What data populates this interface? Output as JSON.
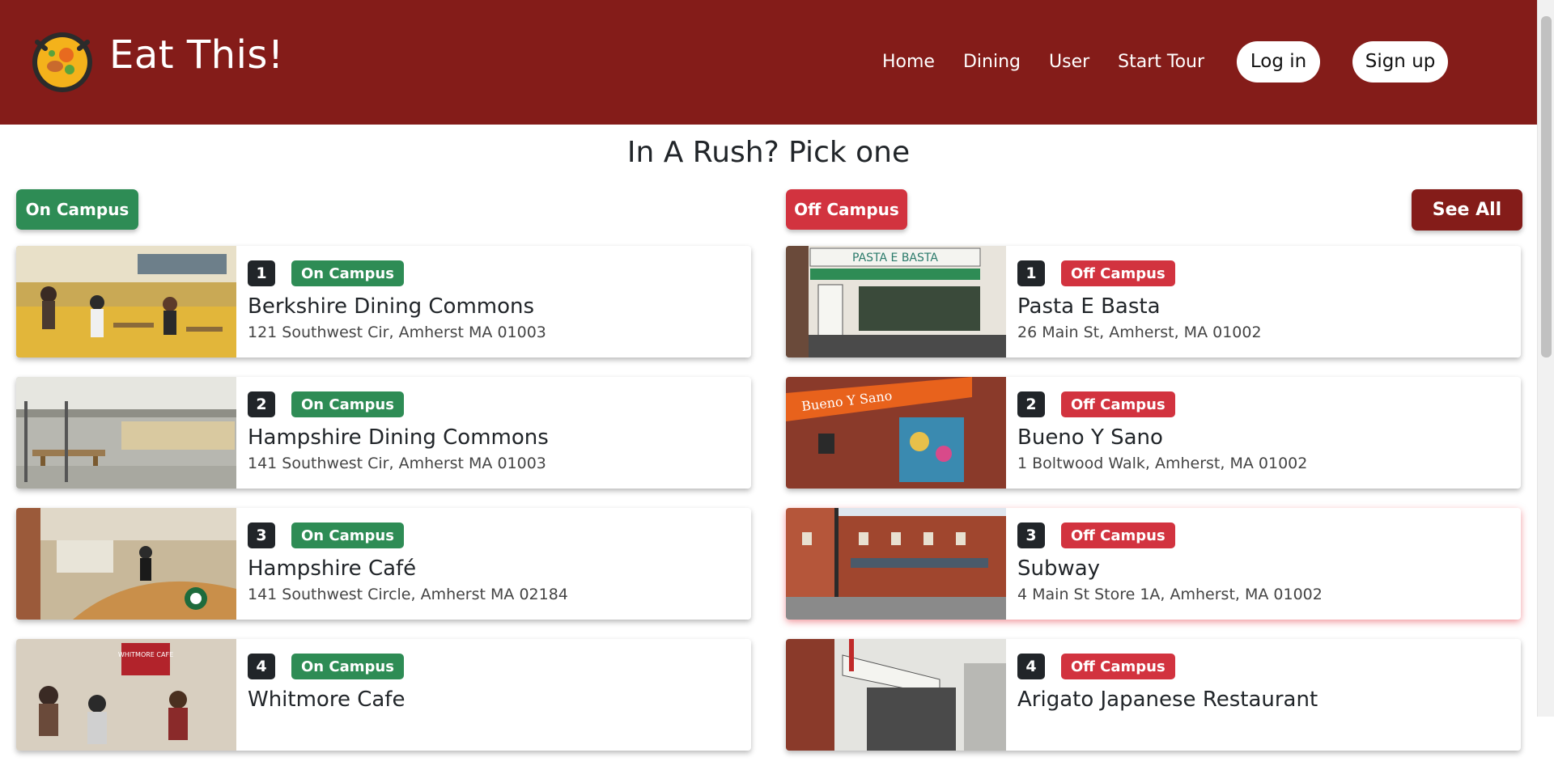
{
  "header": {
    "brand": "Eat This!",
    "nav": [
      "Home",
      "Dining",
      "User",
      "Start Tour"
    ],
    "login_label": "Log in",
    "signup_label": "Sign up",
    "bg_color": "#841c19"
  },
  "main": {
    "heading": "In A Rush? Pick one",
    "on_campus_label": "On Campus",
    "off_campus_label": "Off Campus",
    "see_all_label": "See All"
  },
  "on_campus": [
    {
      "rank": "1",
      "tag": "On Campus",
      "name": "Berkshire Dining Commons",
      "address": "121 Southwest Cir, Amherst MA 01003"
    },
    {
      "rank": "2",
      "tag": "On Campus",
      "name": "Hampshire Dining Commons",
      "address": "141 Southwest Cir, Amherst MA 01003"
    },
    {
      "rank": "3",
      "tag": "On Campus",
      "name": "Hampshire Café",
      "address": "141 Southwest Circle, Amherst MA 02184"
    },
    {
      "rank": "4",
      "tag": "On Campus",
      "name": "Whitmore Cafe",
      "address": ""
    }
  ],
  "off_campus": [
    {
      "rank": "1",
      "tag": "Off Campus",
      "name": "Pasta E Basta",
      "address": "26 Main St, Amherst, MA 01002"
    },
    {
      "rank": "2",
      "tag": "Off Campus",
      "name": "Bueno Y Sano",
      "address": "1 Boltwood Walk, Amherst, MA 01002"
    },
    {
      "rank": "3",
      "tag": "Off Campus",
      "name": "Subway",
      "address": "4 Main St Store 1A, Amherst, MA 01002"
    },
    {
      "rank": "4",
      "tag": "Off Campus",
      "name": "Arigato Japanese Restaurant",
      "address": ""
    }
  ],
  "images": {
    "pasta_sign": "PASTA E BASTA",
    "bueno_sign": "Bueno Y Sano",
    "whitmore_sign": "WHITMORE CAFE"
  }
}
